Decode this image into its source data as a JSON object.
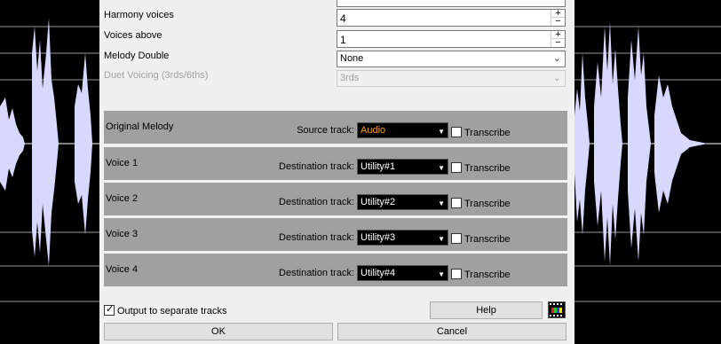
{
  "dialog": {
    "harmony_voices_label": "Harmony voices",
    "harmony_voices_value": "4",
    "voices_above_label": "Voices above",
    "voices_above_value": "1",
    "melody_double_label": "Melody Double",
    "melody_double_value": "None",
    "duet_voicing_label": "Duet Voicing (3rds/6ths)",
    "duet_voicing_value": "3rds",
    "spin_up": "+",
    "spin_down": "−",
    "combo_arrow": "⌄"
  },
  "tracks": [
    {
      "name": "Original Melody",
      "label": "Source track:",
      "value": "Audio",
      "transcribe": "Transcribe"
    },
    {
      "name": "Voice 1",
      "label": "Destination track:",
      "value": "Utility#1",
      "transcribe": "Transcribe"
    },
    {
      "name": "Voice 2",
      "label": "Destination track:",
      "value": "Utility#2",
      "transcribe": "Transcribe"
    },
    {
      "name": "Voice 3",
      "label": "Destination track:",
      "value": "Utility#3",
      "transcribe": "Transcribe"
    },
    {
      "name": "Voice 4",
      "label": "Destination track:",
      "value": "Utility#4",
      "transcribe": "Transcribe"
    }
  ],
  "track_select_arrow": "▼",
  "bottom": {
    "output_separate_label": "Output to separate tracks",
    "output_separate_checked": true,
    "checkmark": "✓",
    "help_label": "Help",
    "ok_label": "OK",
    "cancel_label": "Cancel",
    "film_icon": "film-strip-icon"
  },
  "colors": {
    "waveform": "#d8d8ff",
    "dialog_bg": "#f0f0f0",
    "track_row_bg": "#a0a0a0",
    "source_value": "#f39a1e"
  }
}
